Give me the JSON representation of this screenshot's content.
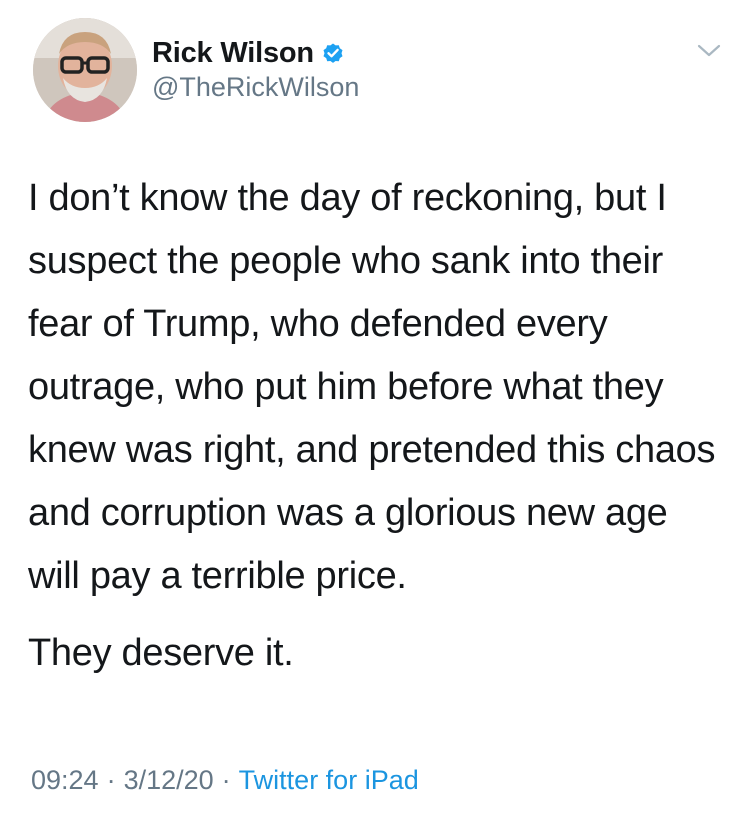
{
  "user": {
    "display_name": "Rick Wilson",
    "handle": "@TheRickWilson",
    "verified": true,
    "avatar_icon": "profile-photo"
  },
  "tweet": {
    "paragraphs": [
      "I don’t know the day of reckoning, but I suspect the people who sank into their fear of Trump, who defended every outrage, who put him before what they knew was right, and pretended this chaos and corruption was a glorious new age will pay a terrible price.",
      "They deserve it."
    ]
  },
  "meta": {
    "time": "09:24",
    "separator": "·",
    "date": "3/12/20",
    "source": "Twitter for iPad"
  },
  "colors": {
    "text": "#14171a",
    "secondary": "#657786",
    "link": "#1b95e0",
    "verified_badge": "#1da1f2"
  },
  "icons": {
    "verified": "verified-badge-icon",
    "caret": "chevron-down-icon"
  }
}
